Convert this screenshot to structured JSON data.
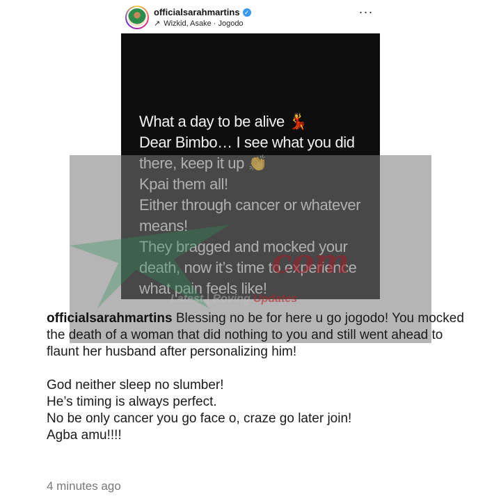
{
  "post": {
    "username": "officialsarahmartins",
    "subtitle": "Wizkid, Asake · Jogodo",
    "icons": {
      "avatar": "profile-avatar",
      "verified": "verified-badge-icon",
      "music": "arrow-icon",
      "more": "more-options-icon"
    },
    "verified_symbol": "✓",
    "arrow_symbol": "↗",
    "more_symbol": "···"
  },
  "story": {
    "text": "What a day to be alive 💃\nDear Bimbo… I see what you did there, keep it up 👏\nKpai them all!\nEither through cancer or whatever means!\nThey bragged and mocked your death, now it’s time to experience what pain feels like!"
  },
  "watermark": {
    "brand": "com",
    "tagline_left": "Latest | Roving",
    "tagline_right": "Updates"
  },
  "caption": {
    "username": "officialsarahmartins",
    "text": " Blessing no be for here u go jogodo! You mocked the death of a woman that did nothing to you and still went ahead to flaunt her husband after personalizing him!\n\nGod neither sleep no slumber!\nHe’s timing is always perfect.\nNo be only cancer you go face o, craze go later join!\nAgba amu!!!!"
  },
  "timestamp": "4 minutes ago",
  "colors": {
    "story_bg": "#0e0e0e",
    "verified": "#3897f0",
    "timestamp": "#777777",
    "watermark_star": "#2f8f5a"
  }
}
